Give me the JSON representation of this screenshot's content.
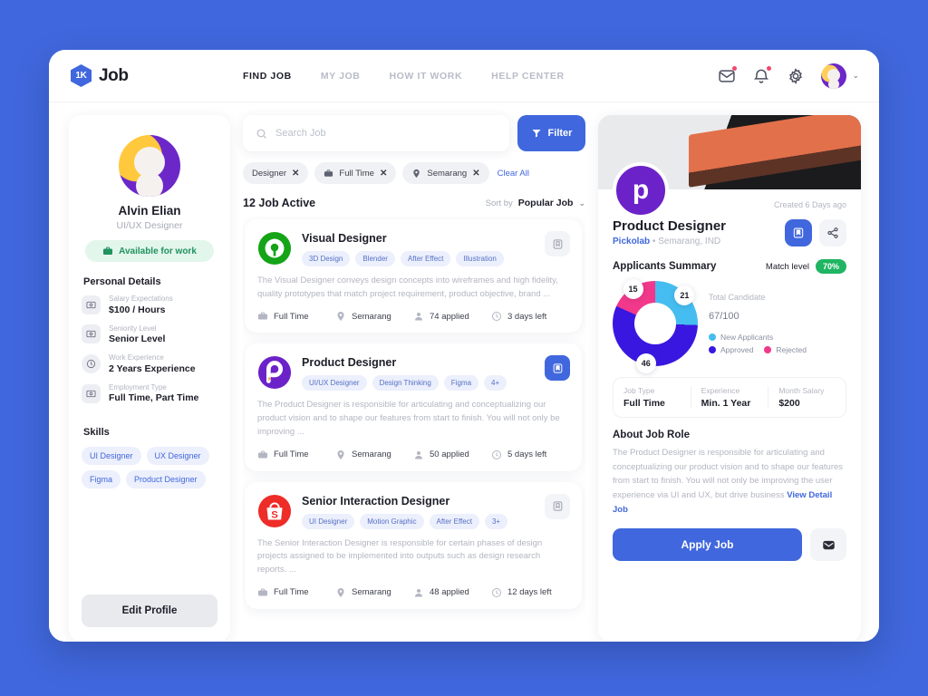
{
  "header": {
    "brand_mark": "1K",
    "brand_name": "Job",
    "nav": [
      {
        "label": "FIND JOB",
        "active": true
      },
      {
        "label": "MY JOB",
        "active": false
      },
      {
        "label": "HOW IT WORK",
        "active": false
      },
      {
        "label": "HELP CENTER",
        "active": false
      }
    ],
    "icons": [
      "mail-icon",
      "bell-icon",
      "gear-icon"
    ],
    "avatar_chevron": "⌄"
  },
  "sidebar": {
    "name": "Alvin Elian",
    "role": "UI/UX Designer",
    "availability": "Available for work",
    "personal_details_title": "Personal Details",
    "details": [
      {
        "label": "Salary Expectations",
        "value": "$100 / Hours",
        "icon": "money-icon"
      },
      {
        "label": "Seniority Level",
        "value": "Senior Level",
        "icon": "badge-icon"
      },
      {
        "label": "Work Experience",
        "value": "2 Years Experience",
        "icon": "clock-icon"
      },
      {
        "label": "Employment Type",
        "value": "Full Time, Part Time",
        "icon": "briefcase-icon"
      }
    ],
    "skills_title": "Skills",
    "skills": [
      "UI Designer",
      "UX Designer",
      "Figma",
      "Product Designer"
    ],
    "edit_profile": "Edit Profile"
  },
  "search": {
    "placeholder": "Search Job",
    "value": "",
    "filter_label": "Filter",
    "chips": [
      {
        "label": "Designer",
        "icon": ""
      },
      {
        "label": "Full Time",
        "icon": "briefcase-icon"
      },
      {
        "label": "Semarang",
        "icon": "pin-icon"
      }
    ],
    "clear_all": "Clear All"
  },
  "list": {
    "count_label": "12 Job Active",
    "sort_label": "Sort by",
    "sort_value": "Popular Job",
    "jobs": [
      {
        "title": "Visual Designer",
        "logo": "gojek-logo",
        "logo_color": "#15a417",
        "tags": [
          "3D Design",
          "Blender",
          "After Effect",
          "Illustration"
        ],
        "description": "The Visual Designer conveys design concepts into wireframes and high fidelity, quality prototypes that match project requirement, product objective, brand ...",
        "type": "Full Time",
        "location": "Semarang",
        "applied": "74 applied",
        "deadline": "3 days left",
        "bookmarked": false
      },
      {
        "title": "Product Designer",
        "logo": "pickolab-logo",
        "logo_color": "#6c22c9",
        "tags": [
          "UI/UX Designer",
          "Design Thinking",
          "Figma",
          "4+"
        ],
        "description": "The Product Designer is responsible for articulating and conceptualizing our product vision and to shape our features from start to finish. You will not only be improving ...",
        "type": "Full Time",
        "location": "Semarang",
        "applied": "50 applied",
        "deadline": "5 days left",
        "bookmarked": true
      },
      {
        "title": "Senior Interaction Designer",
        "logo": "shopee-logo",
        "logo_color": "#ee2c28",
        "tags": [
          "UI Designer",
          "Motion Graphic",
          "After Effect",
          "3+"
        ],
        "description": "The Senior Interaction Designer is responsible for certain phases of design projects assigned to be implemented into outputs such as design research reports. ...",
        "type": "Full Time",
        "location": "Semarang",
        "applied": "48 applied",
        "deadline": "12 days left",
        "bookmarked": false
      }
    ]
  },
  "detail": {
    "created": "Created 6 Days ago",
    "logo_letter": "p",
    "title": "Product Designer",
    "company": "Pickolab",
    "separator": "•",
    "location": "Semarang, IND",
    "summary_title": "Applicants Summary",
    "match_label": "Match level",
    "match_value": "70%",
    "total_label": "Total Candidate",
    "total_value": "67",
    "total_max": "/100",
    "info": [
      {
        "label": "Job Type",
        "value": "Full Time"
      },
      {
        "label": "Experience",
        "value": "Min. 1 Year"
      },
      {
        "label": "Month Salary",
        "value": "$200"
      }
    ],
    "about_title": "About Job Role",
    "about_text": "The Product Designer is responsible for articulating and conceptualizing our product vision and to shape our features from start to finish. You will not only be improving the user experience via UI and UX, but drive business ",
    "about_link": "View Detail Job",
    "apply_label": "Apply Job"
  },
  "chart_data": {
    "type": "pie",
    "title": "Applicants Summary",
    "categories": [
      "New Applicants",
      "Approved",
      "Rejected"
    ],
    "values": [
      21,
      46,
      15
    ],
    "colors": [
      "#45bdf0",
      "#3a17e0",
      "#f2388a"
    ],
    "total": 67,
    "max": 100,
    "legend_position": "right",
    "donut": true
  }
}
